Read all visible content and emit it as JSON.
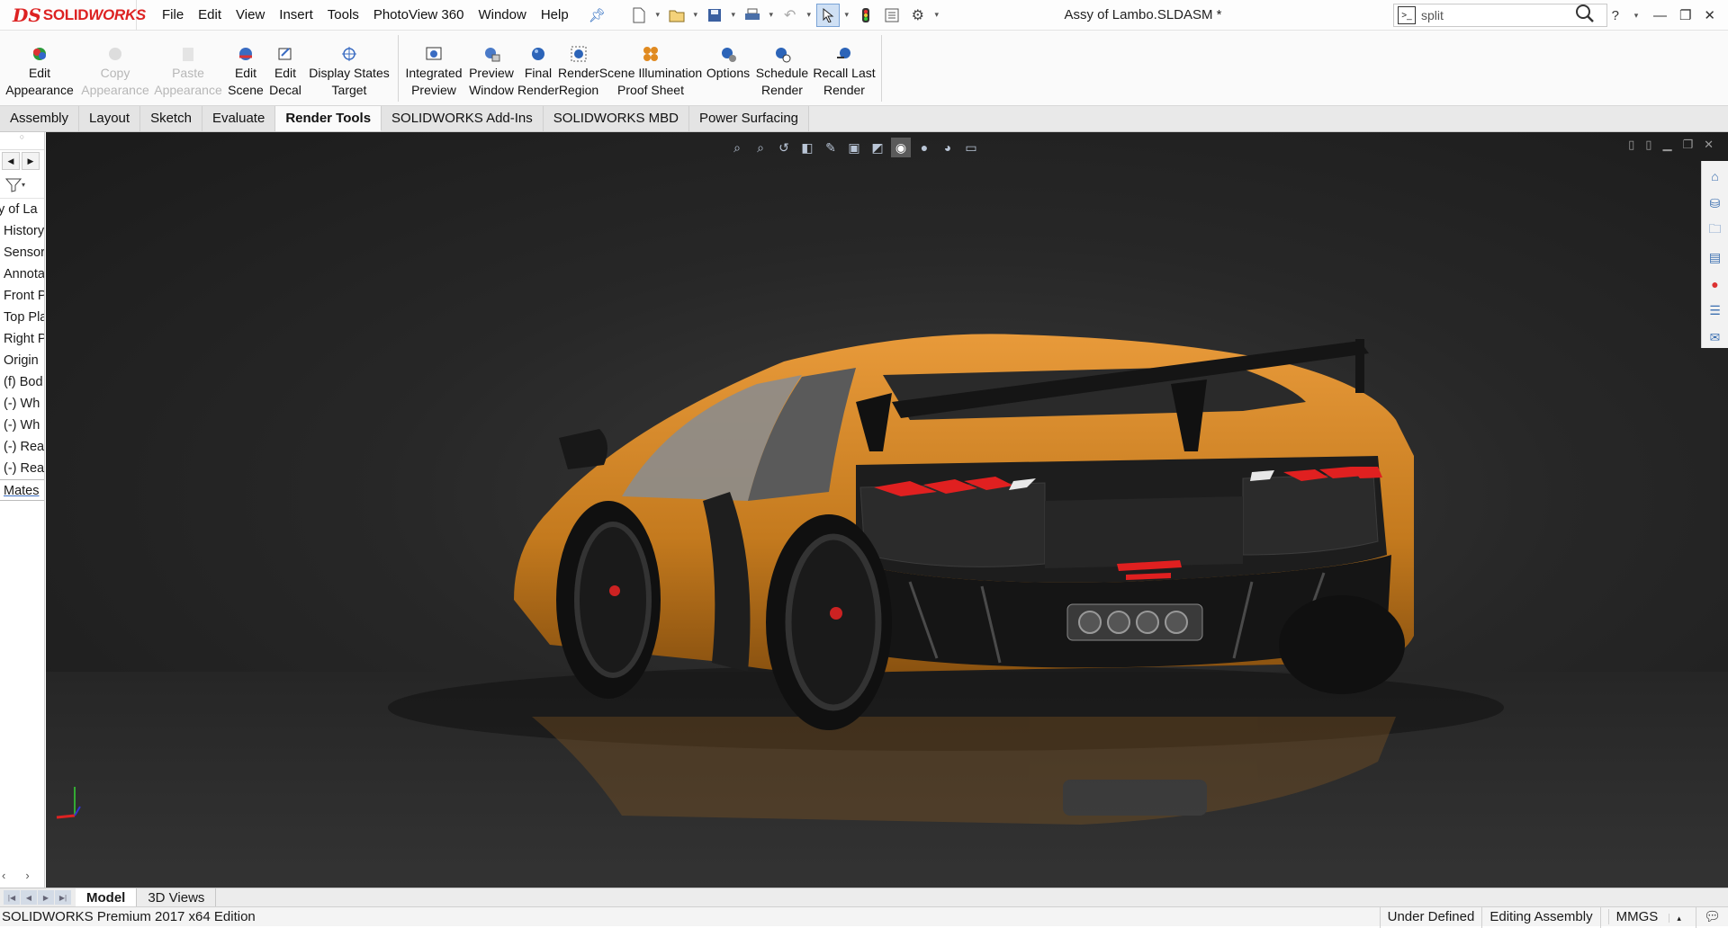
{
  "app": {
    "logo_ds": "DS",
    "logo_text_1": "SOLID",
    "logo_text_2": "WORKS",
    "document_title": "Assy of Lambo.SLDASM *"
  },
  "menu": [
    "File",
    "Edit",
    "View",
    "Insert",
    "Tools",
    "PhotoView 360",
    "Window",
    "Help"
  ],
  "search": {
    "value": "split"
  },
  "ribbon": [
    {
      "label1": "Edit",
      "label2": "Appearance",
      "enabled": true
    },
    {
      "label1": "Copy",
      "label2": "Appearance",
      "enabled": false
    },
    {
      "label1": "Paste",
      "label2": "Appearance",
      "enabled": false
    },
    {
      "label1": "Edit",
      "label2": "Scene",
      "enabled": true
    },
    {
      "label1": "Edit",
      "label2": "Decal",
      "enabled": true
    },
    {
      "label1": "Display States",
      "label2": "Target",
      "enabled": true
    },
    {
      "label1": "Integrated",
      "label2": "Preview",
      "enabled": true
    },
    {
      "label1": "Preview",
      "label2": "Window",
      "enabled": true
    },
    {
      "label1": "Final",
      "label2": "Render",
      "enabled": true
    },
    {
      "label1": "Render",
      "label2": "Region",
      "enabled": true
    },
    {
      "label1": "Scene Illumination",
      "label2": "Proof Sheet",
      "enabled": true
    },
    {
      "label1": "Options",
      "label2": "",
      "enabled": true
    },
    {
      "label1": "Schedule",
      "label2": "Render",
      "enabled": true
    },
    {
      "label1": "Recall Last",
      "label2": "Render",
      "enabled": true
    }
  ],
  "tabs": [
    "Assembly",
    "Layout",
    "Sketch",
    "Evaluate",
    "Render Tools",
    "SOLIDWORKS Add-Ins",
    "SOLIDWORKS MBD",
    "Power Surfacing"
  ],
  "active_tab": "Render Tools",
  "feature_tree": [
    "y of La",
    "History",
    "Sensor",
    "Annota",
    "Front P",
    "Top Pla",
    "Right P",
    "Origin",
    "(f) Bod",
    "(-) Wh",
    "(-) Wh",
    "(-) Rea",
    "(-) Rea",
    "Mates"
  ],
  "model_tabs": [
    "Model",
    "3D Views"
  ],
  "active_model_tab": "Model",
  "status": {
    "edition": "SOLIDWORKS Premium 2017 x64 Edition",
    "definition": "Under Defined",
    "mode": "Editing Assembly",
    "units": "MMGS"
  },
  "colors": {
    "car_body": "#d4892a",
    "taillight": "#e02020",
    "viewport_bg": "#2a2a2a"
  }
}
